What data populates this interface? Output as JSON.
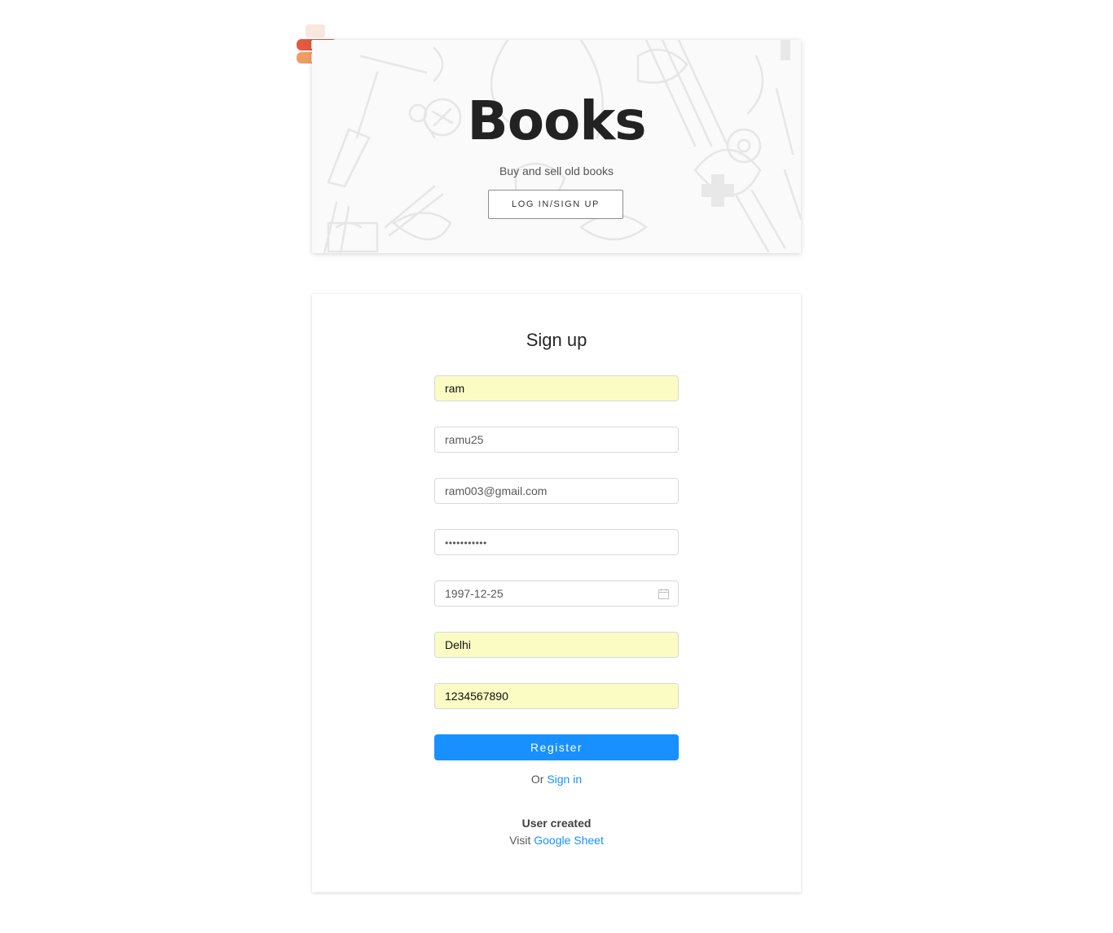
{
  "hero": {
    "title": "Books",
    "subtitle": "Buy and sell old books",
    "button_label": "LOG IN/SIGN UP"
  },
  "logo": {
    "icon": "book-stack-icon",
    "colors": [
      "#e8563f",
      "#ef8f5e",
      "#f6e4d8"
    ]
  },
  "signup": {
    "title": "Sign up",
    "fields": {
      "name": "ram",
      "username": "ramu25",
      "email": "ram003@gmail.com",
      "password": "•••••••••••",
      "dob": "1997-12-25",
      "city": "Delhi",
      "phone": "1234567890"
    },
    "autofill_color": "#fafcc4",
    "register_label": "Register",
    "or_text": "Or",
    "signin_link": "Sign in",
    "status_title": "User created",
    "visit_text": "Visit",
    "sheet_link": "Google Sheet"
  },
  "colors": {
    "accent": "#1890ff",
    "text": "#333333"
  }
}
